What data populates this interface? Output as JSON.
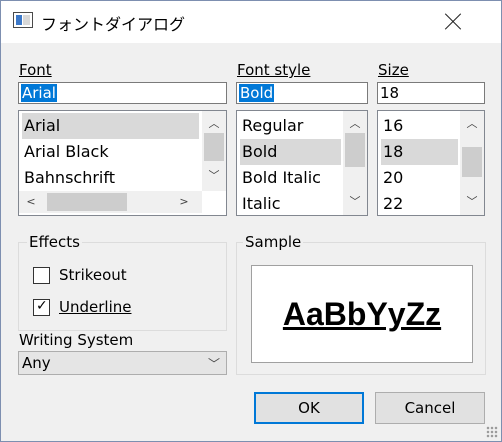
{
  "window": {
    "title": "フォントダイアログ"
  },
  "font": {
    "label": "Font",
    "value": "Arial",
    "items": [
      {
        "label": "Arial",
        "selected": true
      },
      {
        "label": "Arial Black",
        "selected": false
      },
      {
        "label": "Bahnschrift",
        "selected": false
      }
    ]
  },
  "style": {
    "label": "Font style",
    "value": "Bold",
    "items": [
      {
        "label": "Regular",
        "selected": false
      },
      {
        "label": "Bold",
        "selected": true
      },
      {
        "label": "Bold Italic",
        "selected": false
      },
      {
        "label": "Italic",
        "selected": false
      }
    ]
  },
  "size": {
    "label": "Size",
    "value": "18",
    "items": [
      {
        "label": "16",
        "selected": false
      },
      {
        "label": "18",
        "selected": true
      },
      {
        "label": "20",
        "selected": false
      },
      {
        "label": "22",
        "selected": false
      }
    ]
  },
  "effects": {
    "label": "Effects",
    "strikeout": {
      "label": "Strikeout",
      "checked": false
    },
    "underline": {
      "label": "Underline",
      "checked": true
    }
  },
  "writing_system": {
    "label": "Writing System",
    "value": "Any"
  },
  "sample": {
    "label": "Sample",
    "text": "AaBbYyZz"
  },
  "buttons": {
    "ok": "OK",
    "cancel": "Cancel"
  },
  "colors": {
    "selection": "#0078d7",
    "list_highlight": "#d9d9d9",
    "dialog_bg": "#f0f0f0"
  }
}
